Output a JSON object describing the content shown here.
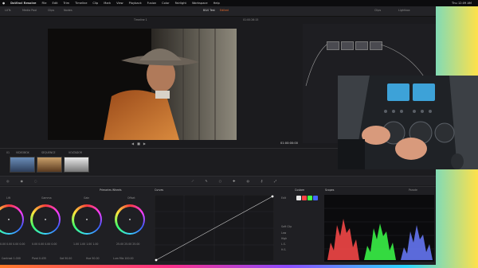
{
  "menubar": {
    "app_name": "DaVinci Resolve",
    "menus": [
      "File",
      "Edit",
      "Trim",
      "Timeline",
      "Clip",
      "Mark",
      "View",
      "Playback",
      "Fusion",
      "Color",
      "Fairlight",
      "Workspace",
      "Help"
    ],
    "status": "Thu 12:09 AM"
  },
  "toolbar": {
    "left_tabs": [
      "LUTs",
      "Media Pool",
      "Clips",
      "Nodes"
    ],
    "project_title": "B&S Test",
    "project_badge": "Edited",
    "right_tabs": [
      "Clips",
      "Lightbox"
    ]
  },
  "viewer": {
    "timeline_name": "Timeline 1",
    "timecode_top": "01:00:26:15",
    "timecode": "01:00:00:00"
  },
  "clips": {
    "labels": [
      "01",
      "02",
      "03",
      "04"
    ],
    "names": [
      "VIDEOBOX",
      "SEQUENCE",
      "SEQUENCE",
      "VOLTADOR"
    ]
  },
  "color_panel": {
    "title": "Primaries Wheels",
    "wheels": [
      "Lift",
      "Gamma",
      "Gain",
      "Offset"
    ],
    "values": {
      "lift": "0.00  0.00  0.00  0.00",
      "gamma": "0.00  0.00  0.00  0.00",
      "gain": "1.00  1.00  1.00  1.00",
      "offset": "25.00  25.00  25.00"
    },
    "bottom_row": [
      "Contrast 1.000",
      "Pivot 0.435",
      "Sat 50.00",
      "Hue 50.00",
      "Lum Mix 100.00"
    ]
  },
  "curves_panel": {
    "title": "Curves"
  },
  "custom_panel": {
    "title": "Custom",
    "labels": [
      "Edit",
      "Soft Clip",
      "Low",
      "High",
      "L.S.",
      "H.S."
    ]
  },
  "scopes_panel": {
    "title": "Scopes",
    "mode": "Parade"
  },
  "colors": {
    "accent_orange": "#e8692a",
    "scope_red": "#ff4a4a",
    "scope_green": "#3cff4a",
    "scope_blue": "#6a7bff"
  }
}
